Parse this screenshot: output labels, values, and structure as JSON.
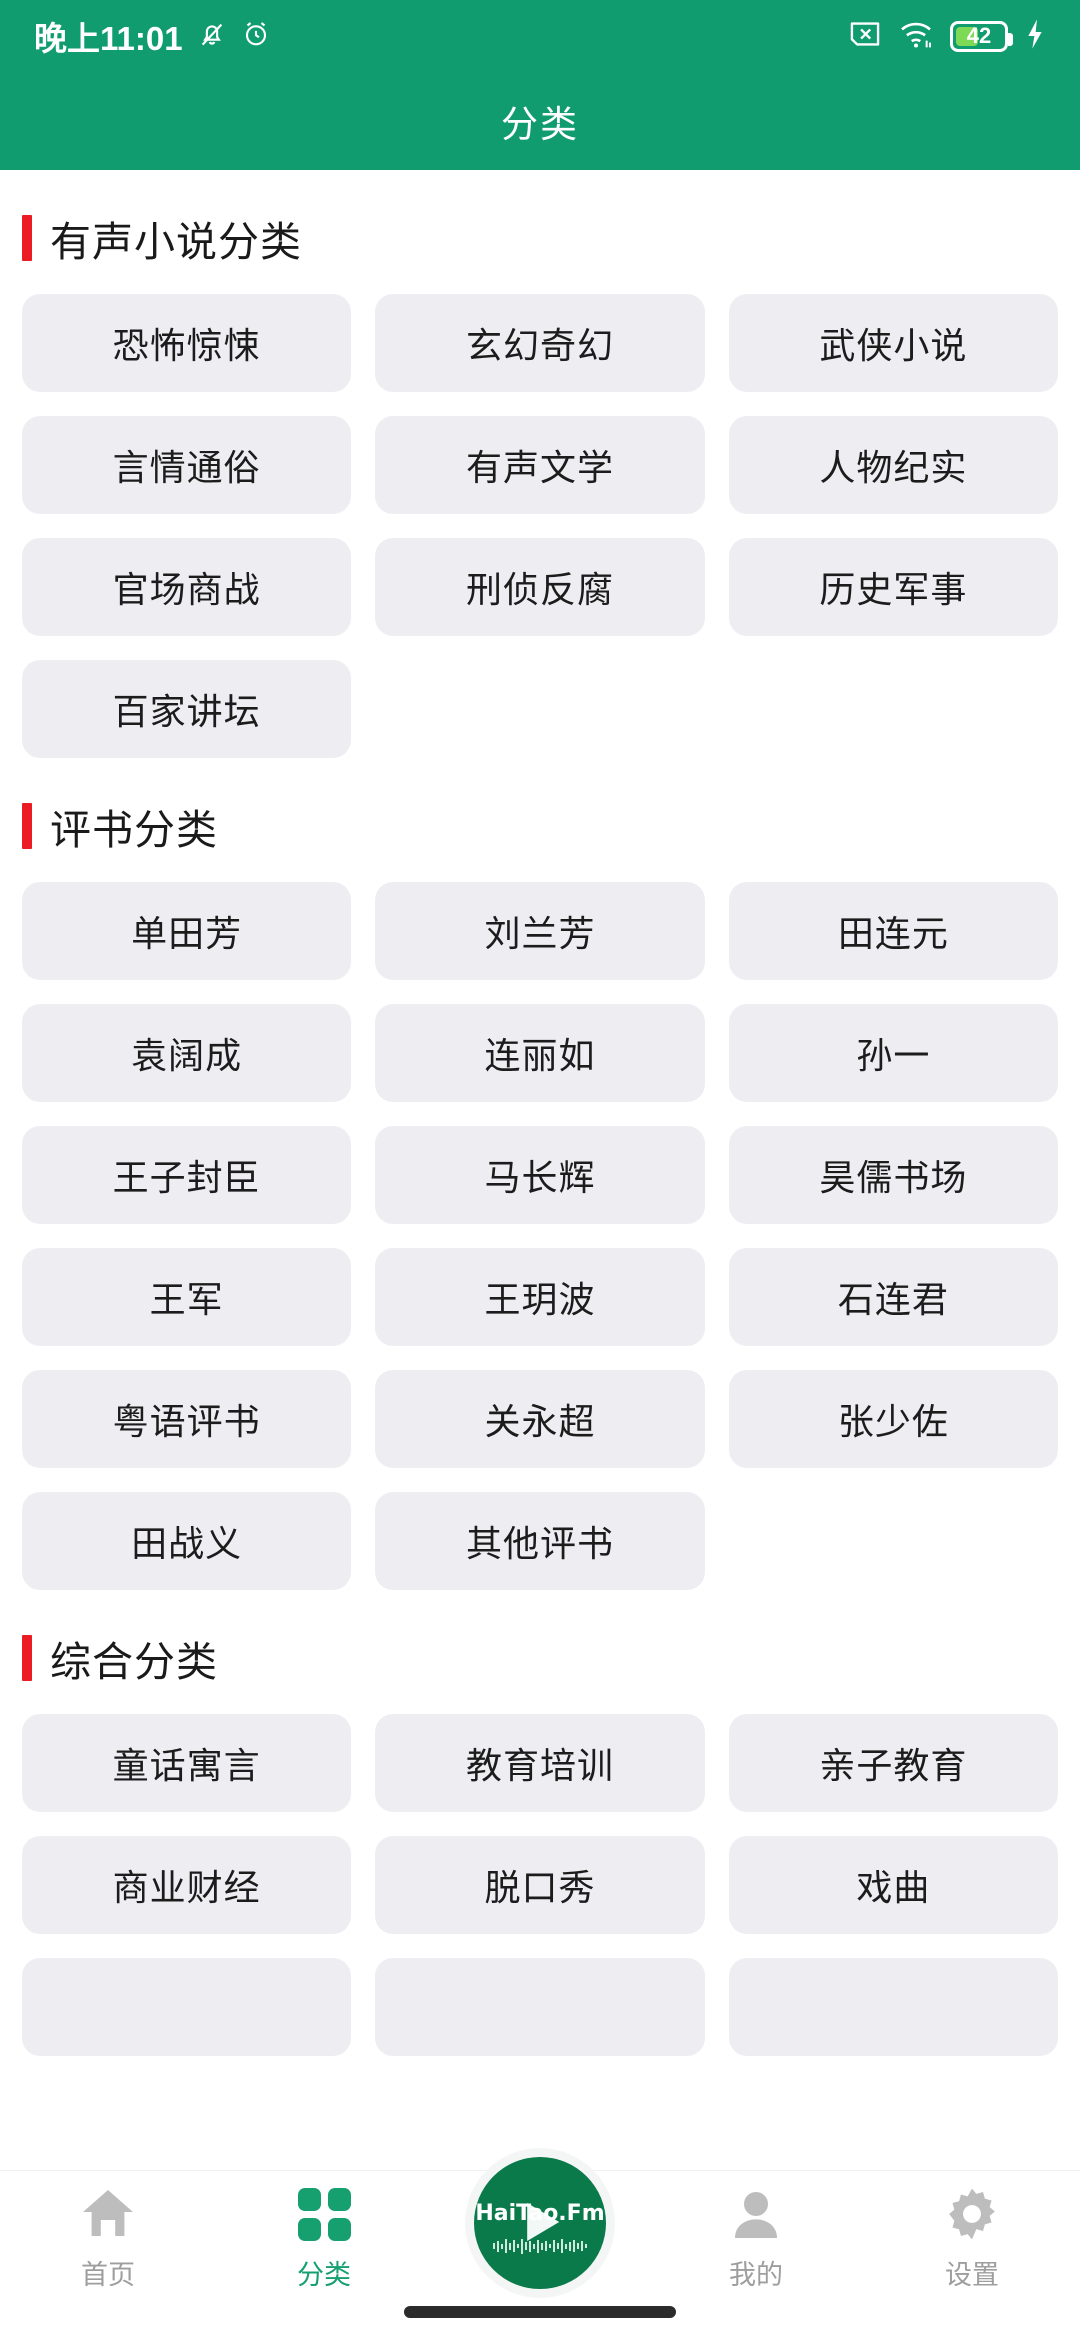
{
  "statusbar": {
    "time": "晚上11:01",
    "icons": [
      "bell-off-icon",
      "alarm-icon",
      "sim-x-icon",
      "wifi-icon",
      "battery-icon",
      "charging-icon"
    ],
    "battery_level": "42"
  },
  "header": {
    "title": "分类",
    "background_color": "#109c6e"
  },
  "accent": {
    "section_bar_color": "#ec1c24",
    "tile_background": "#eeeef2",
    "active_tab_color": "#16a070"
  },
  "sections": [
    {
      "title": "有声小说分类",
      "items": [
        "恐怖惊悚",
        "玄幻奇幻",
        "武侠小说",
        "言情通俗",
        "有声文学",
        "人物纪实",
        "官场商战",
        "刑侦反腐",
        "历史军事",
        "百家讲坛"
      ]
    },
    {
      "title": "评书分类",
      "items": [
        "单田芳",
        "刘兰芳",
        "田连元",
        "袁阔成",
        "连丽如",
        "孙一",
        "王子封臣",
        "马长辉",
        "昊儒书场",
        "王军",
        "王玥波",
        "石连君",
        "粤语评书",
        "关永超",
        "张少佐",
        "田战义",
        "其他评书"
      ]
    },
    {
      "title": "综合分类",
      "items": [
        "童话寓言",
        "教育培训",
        "亲子教育",
        "商业财经",
        "脱口秀",
        "戏曲",
        "",
        "",
        ""
      ]
    }
  ],
  "tabbar": {
    "items": [
      {
        "label": "首页",
        "icon": "home-icon",
        "active": false
      },
      {
        "label": "分类",
        "icon": "grid-icon",
        "active": true
      },
      {
        "label": "",
        "icon": "play-logo-icon",
        "active": false
      },
      {
        "label": "我的",
        "icon": "person-icon",
        "active": false
      },
      {
        "label": "设置",
        "icon": "gear-icon",
        "active": false
      }
    ],
    "logo_text": "HaiTao.Fm"
  }
}
